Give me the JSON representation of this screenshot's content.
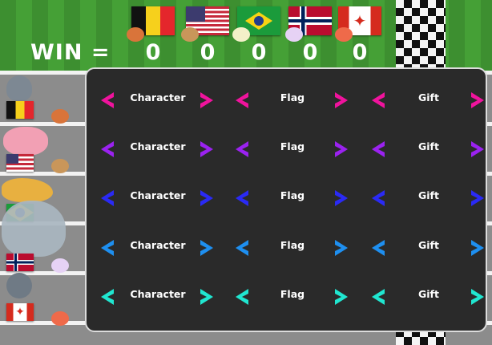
{
  "win_label": "WIN =",
  "scores": [
    "0",
    "0",
    "0",
    "0",
    "0"
  ],
  "players": [
    {
      "country": "Belgium",
      "color": "#f0139d"
    },
    {
      "country": "United States",
      "color": "#9b22f0"
    },
    {
      "country": "Brazil",
      "color": "#2a2af5"
    },
    {
      "country": "Norway",
      "color": "#1e8ff0"
    },
    {
      "country": "Canada",
      "color": "#20e6d0"
    }
  ],
  "panel": {
    "rows": [
      {
        "character": "Character",
        "flag": "Flag",
        "gift": "Gift"
      },
      {
        "character": "Character",
        "flag": "Flag",
        "gift": "Gift"
      },
      {
        "character": "Character",
        "flag": "Flag",
        "gift": "Gift"
      },
      {
        "character": "Character",
        "flag": "Flag",
        "gift": "Gift"
      },
      {
        "character": "Character",
        "flag": "Flag",
        "gift": "Gift"
      }
    ]
  },
  "icons": {
    "left": "chevron-left-icon",
    "right": "chevron-right-icon",
    "maple": "maple-leaf-icon"
  },
  "maple_glyph": "✦"
}
